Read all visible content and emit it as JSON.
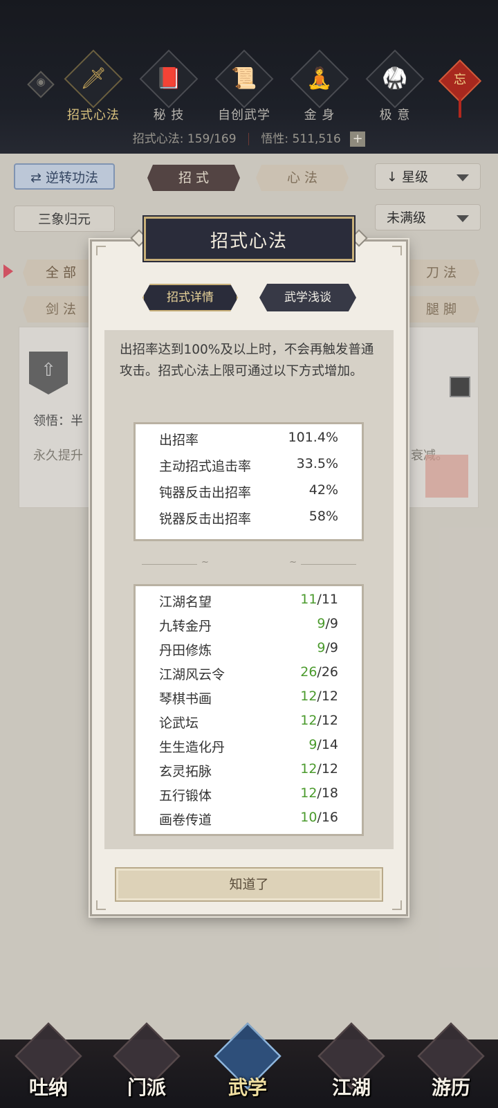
{
  "top_nav": {
    "items": [
      {
        "label": "招式心法",
        "icon": "sword-icon",
        "glyph": "🗡",
        "active": true
      },
      {
        "label": "秘 技",
        "icon": "book-icon",
        "glyph": "📕",
        "active": false
      },
      {
        "label": "自创武学",
        "icon": "scroll-icon",
        "glyph": "📜",
        "active": false
      },
      {
        "label": "金 身",
        "icon": "meditation-icon",
        "glyph": "🧘",
        "active": false
      },
      {
        "label": "极 意",
        "icon": "fighter-icon",
        "glyph": "🥋",
        "active": false
      }
    ],
    "knot_glyph": "忘",
    "stats": {
      "moves_label": "招式心法:",
      "moves_value": "159/169",
      "insight_label": "悟性:",
      "insight_value": "511,516",
      "plus": "+"
    }
  },
  "filters": {
    "reverse_button": "逆转功法",
    "reverse_icon": "⇄",
    "tab_moves": "招 式",
    "tab_methods": "心 法",
    "sort_select": "星级",
    "sort_arrow": "↓",
    "sanxiang_button": "三象归元",
    "level_select": "未满级",
    "chips": [
      "全 部",
      "剑 法",
      "刀 法",
      "腿 脚"
    ]
  },
  "background_card": {
    "comprehension": "领悟：半",
    "desc_partial": "永久提升",
    "desc_tail": "衰减。"
  },
  "modal": {
    "title": "招式心法",
    "tab_details": "招式详情",
    "tab_talk": "武学浅谈",
    "description": "出招率达到100%及以上时，不会再触发普通攻击。招式心法上限可通过以下方式增加。",
    "rates": [
      {
        "label": "出招率",
        "value": "101.4%"
      },
      {
        "label": "主动招式追击率",
        "value": "33.5%"
      },
      {
        "label": "钝器反击出招率",
        "value": "42%"
      },
      {
        "label": "锐器反击出招率",
        "value": "58%"
      }
    ],
    "sources": [
      {
        "label": "江湖名望",
        "current": "11",
        "max": "/11"
      },
      {
        "label": "九转金丹",
        "current": "9",
        "max": "/9"
      },
      {
        "label": "丹田修炼",
        "current": "9",
        "max": "/9"
      },
      {
        "label": "江湖风云令",
        "current": "26",
        "max": "/26"
      },
      {
        "label": "琴棋书画",
        "current": "12",
        "max": "/12"
      },
      {
        "label": "论武坛",
        "current": "12",
        "max": "/12"
      },
      {
        "label": "生生造化丹",
        "current": "9",
        "max": "/14"
      },
      {
        "label": "玄灵拓脉",
        "current": "12",
        "max": "/12"
      },
      {
        "label": "五行锻体",
        "current": "12",
        "max": "/18"
      },
      {
        "label": "画卷传道",
        "current": "10",
        "max": "/16"
      }
    ],
    "ok_button": "知道了"
  },
  "bottom_nav": {
    "items": [
      {
        "label": "吐纳",
        "icon": "breathing-icon",
        "active": false
      },
      {
        "label": "门派",
        "icon": "sect-icon",
        "active": false
      },
      {
        "label": "武学",
        "icon": "martial-books-icon",
        "active": true
      },
      {
        "label": "江湖",
        "icon": "jianghu-icon",
        "active": false
      },
      {
        "label": "游历",
        "icon": "horse-icon",
        "active": false
      }
    ]
  },
  "colors": {
    "accent_gold": "#c8b079",
    "dark_panel": "#2a2c3a",
    "current_value_green": "#4a9a2c"
  }
}
